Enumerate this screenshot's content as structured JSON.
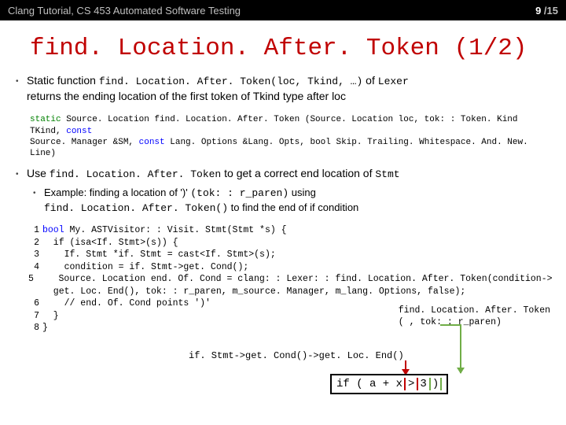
{
  "header": {
    "course": "Clang Tutorial, CS 453 Automated Software Testing",
    "page_current": "9",
    "page_sep": " /",
    "page_total": "15"
  },
  "title": "find. Location. After. Token (1/2)",
  "bullet1_a": "Static function ",
  "bullet1_b": "find. Location. After. Token(loc, Tkind, …)",
  "bullet1_c": " of ",
  "bullet1_d": "Lexer",
  "bullet1_line2": "returns the ending location of the first token of Tkind type after loc",
  "sig": {
    "kw_static": "static",
    "t1": " Source. Location find. Location. After. Token (Source. Location loc, tok: : Token. Kind TKind, ",
    "kw_const1": "const",
    "t2": "Source. Manager &SM, ",
    "kw_const2": "const",
    "t3": " Lang. Options &Lang. Opts, bool Skip. Trailing. Whitespace. And. New. Line)"
  },
  "bullet2_a": "Use ",
  "bullet2_b": "find. Location. After. Token",
  "bullet2_c": " to get a correct end location of ",
  "bullet2_d": "Stmt",
  "sub_a": "Example: finding a location of ')' ",
  "sub_b": "(tok: : r_paren)",
  "sub_c": " using",
  "sub_line2": "find. Location. After. Token()",
  "sub_line2_tail": " to find the end of if condition",
  "code": {
    "l1": "bool My. ASTVisitor: : Visit. Stmt(Stmt *s) {",
    "l2": "  if (isa<If. Stmt>(s)) {",
    "l3": "    If. Stmt *if. Stmt = cast<If. Stmt>(s);",
    "l4": "    condition = if. Stmt->get. Cond();",
    "l5": "    Source. Location end. Of. Cond = clang: : Lexer: : find. Location. After. Token(condition->",
    "l5b": "  get. Loc. End(), tok: : r_paren, m_source. Manager, m_lang. Options, false);",
    "l6": "    // end. Of. Cond points ')'",
    "l7": "  }",
    "l8": "}"
  },
  "anno_right_l1": "find. Location. After. Token",
  "anno_right_l2": "(  , tok: : r_paren)",
  "anno_mid": "if. Stmt->get. Cond()->get. Loc. End()",
  "ifbox_a": "if ( a + x ",
  "ifbox_gt": ">",
  "ifbox_b": " 3 ",
  "ifbox_paren": ")"
}
